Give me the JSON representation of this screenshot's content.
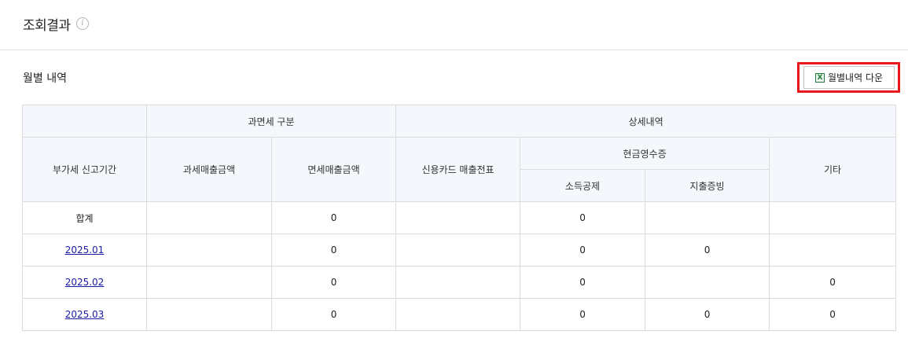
{
  "result": {
    "title": "조회결과",
    "info_icon_glyph": "i"
  },
  "monthly": {
    "title": "월별 내역",
    "download_label": "월별내역 다운",
    "excel_icon_glyph": "X",
    "highlight_color": "#e8161d"
  },
  "table": {
    "headers": {
      "taxation_group": "과면세 구분",
      "detail_group": "상세내역",
      "period": "부가세 신고기간",
      "taxable_sales": "과세매출금액",
      "exempt_sales": "면세매출금액",
      "credit_card": "신용카드 매출전표",
      "cash_receipt": "현금영수증",
      "income_deduction": "소득공제",
      "expense_proof": "지출증빙",
      "other": "기타"
    },
    "rows": [
      {
        "period": "합계",
        "taxable_sales": "",
        "exempt_sales": "0",
        "credit_card": "",
        "income_deduction": "0",
        "expense_proof": "",
        "other": ""
      },
      {
        "period": "2025.01",
        "taxable_sales": "",
        "exempt_sales": "0",
        "credit_card": "",
        "income_deduction": "0",
        "expense_proof": "0",
        "other": ""
      },
      {
        "period": "2025.02",
        "taxable_sales": "",
        "exempt_sales": "0",
        "credit_card": "",
        "income_deduction": "0",
        "expense_proof": "",
        "other": "0"
      },
      {
        "period": "2025.03",
        "taxable_sales": "",
        "exempt_sales": "0",
        "credit_card": "",
        "income_deduction": "0",
        "expense_proof": "0",
        "other": "0"
      }
    ]
  }
}
